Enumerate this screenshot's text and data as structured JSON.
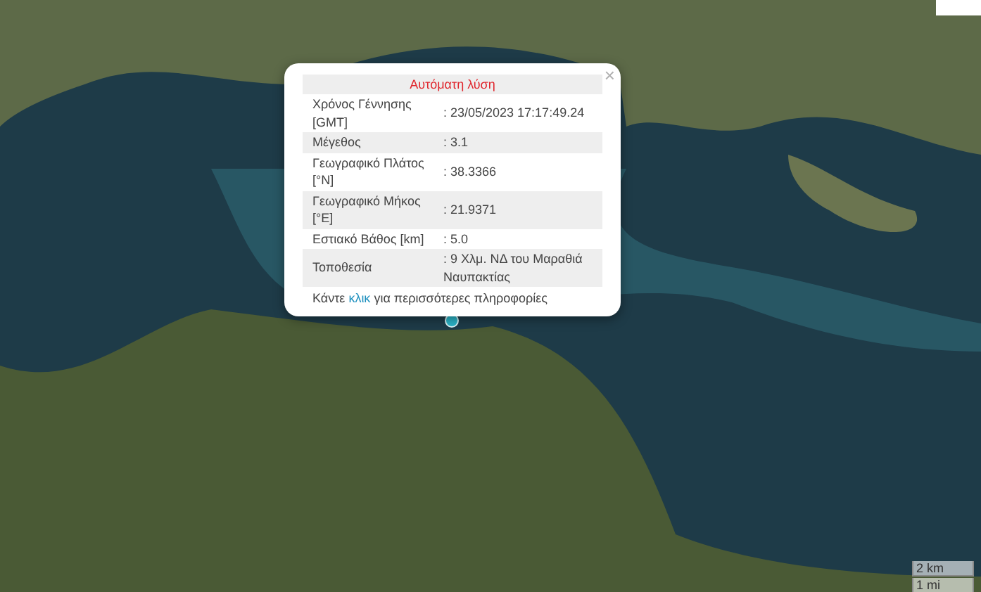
{
  "popup": {
    "close": "×",
    "title": "Αυτόματη λύση",
    "rows": [
      {
        "label": "Χρόνος Γέννησης [GMT]",
        "value": ": 23/05/2023 17:17:49.24"
      },
      {
        "label": "Μέγεθος",
        "value": ": 3.1"
      },
      {
        "label": "Γεωγραφικό Πλάτος [°N]",
        "value": ": 38.3366"
      },
      {
        "label": "Γεωγραφικό Μήκος [°E]",
        "value": ": 21.9371"
      },
      {
        "label": "Εστιακό Βάθος [km]",
        "value": ": 5.0"
      },
      {
        "label": "Τοποθεσία",
        "value": ": 9 Χλμ. ΝΔ του Μαραθιά Ναυπακτίας"
      }
    ],
    "footer_before": "Κάντε",
    "footer_link": "κλικ",
    "footer_after": "για περισσότερες πληροφορίες"
  },
  "scale": {
    "metric": "2 km",
    "imperial": "1 mi"
  }
}
